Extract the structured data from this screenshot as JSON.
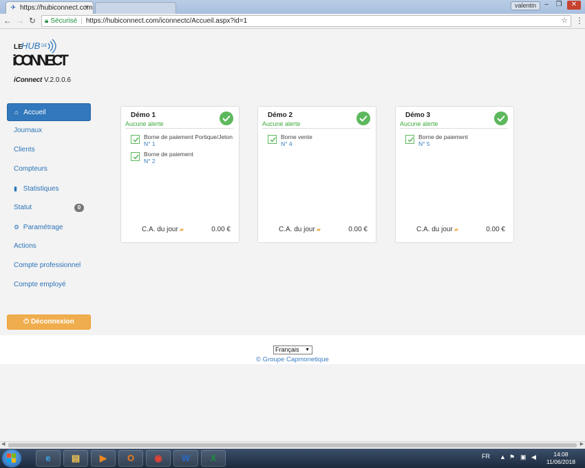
{
  "browser": {
    "tab_title": "https://hubiconnect.com",
    "tab_close": "×",
    "user_label": "valentin",
    "secure_label": "Sécurisé",
    "url": "https://hubiconnect.com/iconnectc/Accueil.aspx?id=1"
  },
  "app": {
    "logo_text_top": "LE HUB DE",
    "logo_text_main": "iCONNECT",
    "version_brand": "iConnect",
    "version": "V.2.0.0.6"
  },
  "sidebar": {
    "items": [
      {
        "label": "Accueil",
        "icon": "home-icon",
        "active": true
      },
      {
        "label": "Journaux"
      },
      {
        "label": "Clients"
      },
      {
        "label": "Compteurs"
      },
      {
        "label": "Statistiques",
        "icon": "bar-chart-icon"
      },
      {
        "label": "Statut",
        "badge": "0"
      },
      {
        "label": "Paramétrage",
        "icon": "gear-icon"
      },
      {
        "label": "Actions"
      },
      {
        "label": "Compte professionnel"
      },
      {
        "label": "Compte employé"
      }
    ],
    "logout_label": "Déconnexion"
  },
  "cards": [
    {
      "title": "Démo 1",
      "alert": "Aucune alerte",
      "devices": [
        {
          "name": "Borne de paiement Portique/Jeton",
          "number": "N° 1"
        },
        {
          "name": "Borne de paiement",
          "number": "N° 2"
        }
      ],
      "ca_label": "C.A. du jour",
      "amount": "0.00 €"
    },
    {
      "title": "Démo 2",
      "alert": "Aucune alerte",
      "devices": [
        {
          "name": "Borne vente",
          "number": "N° 4"
        }
      ],
      "ca_label": "C.A. du jour",
      "amount": "0.00 €"
    },
    {
      "title": "Démo 3",
      "alert": "Aucune alerte",
      "devices": [
        {
          "name": "Borne de paiement",
          "number": "N° 5"
        }
      ],
      "ca_label": "C.A. du jour",
      "amount": "0.00 €"
    }
  ],
  "footer": {
    "language": "Français",
    "copyright": "© Groupe Capmonetique"
  },
  "taskbar": {
    "lang": "FR",
    "time": "14:08",
    "date": "11/06/2018"
  },
  "colors": {
    "primary": "#3278bc",
    "link": "#2a73b8",
    "success": "#5cb85c",
    "warning": "#f0ad4e"
  }
}
